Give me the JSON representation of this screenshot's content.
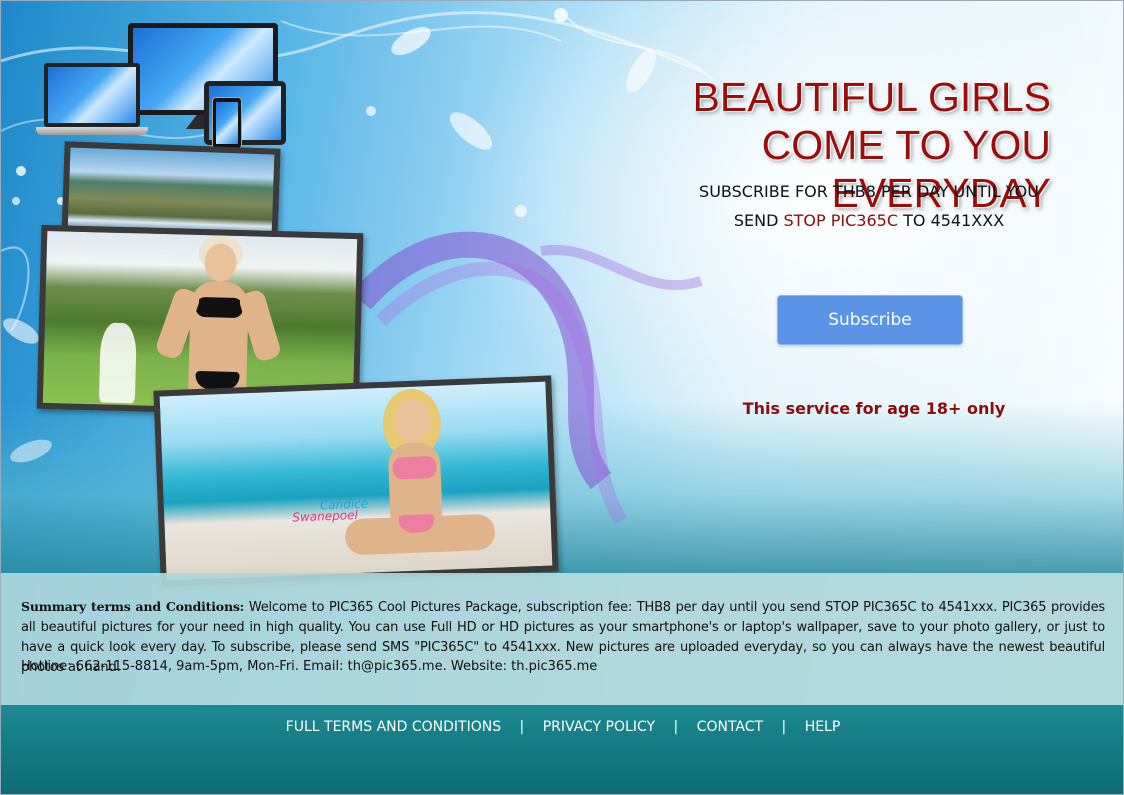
{
  "headline": {
    "line1": "BEAUTIFUL GIRLS",
    "line2": "COME TO YOU EVERYDAY"
  },
  "subscription": {
    "line1": "SUBSCRIBE FOR THB8 PER DAY UNTIL YOU",
    "send_label": "SEND",
    "stop_code": "STOP PIC365C",
    "to_label": "TO",
    "short_code": "4541XXX",
    "button_label": "Subscribe"
  },
  "age_note": "This service for age 18+ only",
  "photo_caption": {
    "first": "Candice",
    "last": "Swanepoel"
  },
  "terms": {
    "lead": "Summary terms and Conditions:",
    "body": "Welcome to PIC365 Cool Pictures Package, subscription fee: THB8 per day until you send STOP PIC365C to 4541xxx. PIC365 provides all beautiful pictures for your need in high quality. You can use Full HD or HD pictures as your smartphone's or laptop's wallpaper, save to your photo gallery, or just to have a quick look every day. To subscribe, please send SMS \"PIC365C\" to 4541xxx. New pictures are uploaded everyday, so you can always have the newest beautiful photos at hand.",
    "hotline": "Hotline: 662-115-8814, 9am-5pm, Mon-Fri. Email: th@pic365.me. Website: th.pic365.me"
  },
  "footer": {
    "links": [
      "FULL TERMS AND CONDITIONS",
      "PRIVACY POLICY",
      "CONTACT",
      "HELP"
    ],
    "separator": "|"
  },
  "colors": {
    "headline_red": "#9b0d0d",
    "button_blue": "#5b94e6",
    "footer_teal": "#13787f"
  }
}
